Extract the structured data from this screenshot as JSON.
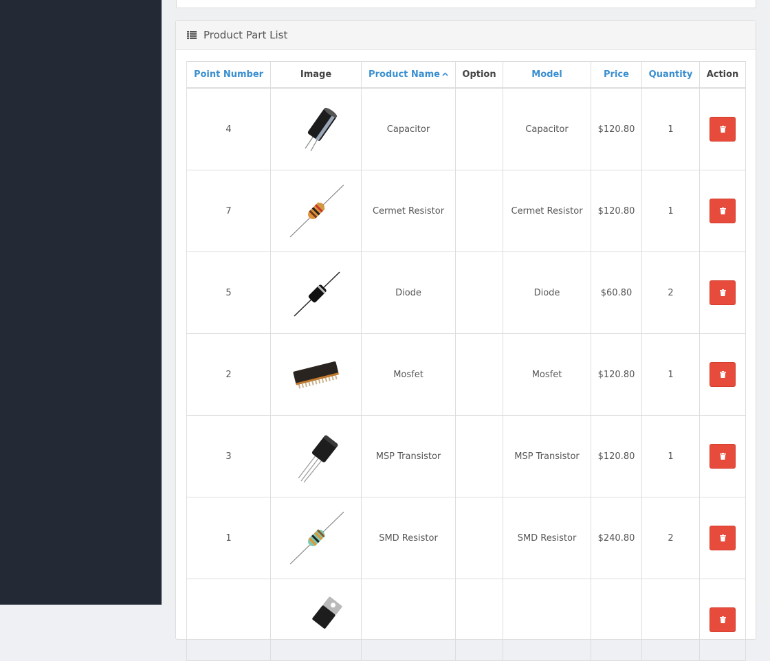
{
  "panel": {
    "title": "Product Part List",
    "icon": "list-icon"
  },
  "table": {
    "columns": [
      {
        "label": "Point Number",
        "sortable": true
      },
      {
        "label": "Image",
        "sortable": false
      },
      {
        "label": "Product Name",
        "sortable": true,
        "sorted": "asc",
        "sort_glyph": "^"
      },
      {
        "label": "Option",
        "sortable": false
      },
      {
        "label": "Model",
        "sortable": true
      },
      {
        "label": "Price",
        "sortable": true
      },
      {
        "label": "Quantity",
        "sortable": true
      },
      {
        "label": "Action",
        "sortable": false
      }
    ],
    "rows": [
      {
        "point": "4",
        "image": "capacitor-image",
        "name": "Capacitor",
        "option": "",
        "model": "Capacitor",
        "price": "$120.80",
        "qty": "1"
      },
      {
        "point": "7",
        "image": "cermet-resistor-image",
        "name": "Cermet Resistor",
        "option": "",
        "model": "Cermet Resistor",
        "price": "$120.80",
        "qty": "1"
      },
      {
        "point": "5",
        "image": "diode-image",
        "name": "Diode",
        "option": "",
        "model": "Diode",
        "price": "$60.80",
        "qty": "2"
      },
      {
        "point": "2",
        "image": "mosfet-image",
        "name": "Mosfet",
        "option": "",
        "model": "Mosfet",
        "price": "$120.80",
        "qty": "1"
      },
      {
        "point": "3",
        "image": "transistor-image",
        "name": "MSP Transistor",
        "option": "",
        "model": "MSP Transistor",
        "price": "$120.80",
        "qty": "1"
      },
      {
        "point": "1",
        "image": "smd-resistor-image",
        "name": "SMD Resistor",
        "option": "",
        "model": "SMD Resistor",
        "price": "$240.80",
        "qty": "2"
      },
      {
        "point": "",
        "image": "voltage-regulator-image",
        "name": "",
        "option": "",
        "model": "",
        "price": "",
        "qty": ""
      }
    ],
    "action_icon": "trash-icon"
  },
  "colors": {
    "sidebar": "#232a36",
    "link": "#3a8fd0",
    "danger": "#e64b3b"
  }
}
